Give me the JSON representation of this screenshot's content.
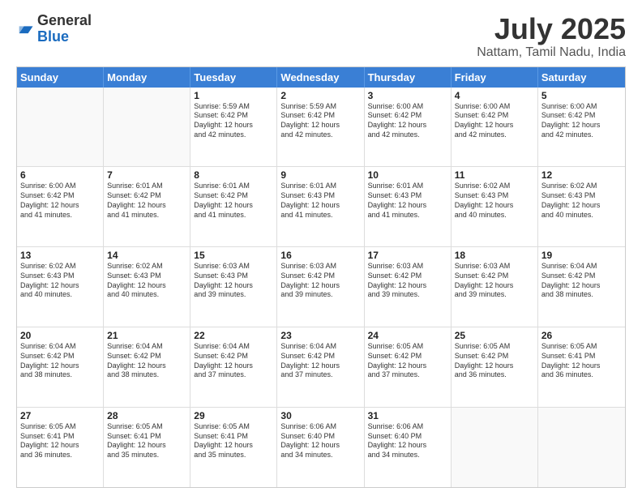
{
  "logo": {
    "general": "General",
    "blue": "Blue"
  },
  "header": {
    "title": "July 2025",
    "subtitle": "Nattam, Tamil Nadu, India"
  },
  "calendar": {
    "days": [
      "Sunday",
      "Monday",
      "Tuesday",
      "Wednesday",
      "Thursday",
      "Friday",
      "Saturday"
    ],
    "weeks": [
      [
        {
          "day": "",
          "empty": true
        },
        {
          "day": "",
          "empty": true
        },
        {
          "day": "1",
          "sunrise": "Sunrise: 5:59 AM",
          "sunset": "Sunset: 6:42 PM",
          "daylight": "Daylight: 12 hours and 42 minutes."
        },
        {
          "day": "2",
          "sunrise": "Sunrise: 5:59 AM",
          "sunset": "Sunset: 6:42 PM",
          "daylight": "Daylight: 12 hours and 42 minutes."
        },
        {
          "day": "3",
          "sunrise": "Sunrise: 6:00 AM",
          "sunset": "Sunset: 6:42 PM",
          "daylight": "Daylight: 12 hours and 42 minutes."
        },
        {
          "day": "4",
          "sunrise": "Sunrise: 6:00 AM",
          "sunset": "Sunset: 6:42 PM",
          "daylight": "Daylight: 12 hours and 42 minutes."
        },
        {
          "day": "5",
          "sunrise": "Sunrise: 6:00 AM",
          "sunset": "Sunset: 6:42 PM",
          "daylight": "Daylight: 12 hours and 42 minutes."
        }
      ],
      [
        {
          "day": "6",
          "sunrise": "Sunrise: 6:00 AM",
          "sunset": "Sunset: 6:42 PM",
          "daylight": "Daylight: 12 hours and 41 minutes."
        },
        {
          "day": "7",
          "sunrise": "Sunrise: 6:01 AM",
          "sunset": "Sunset: 6:42 PM",
          "daylight": "Daylight: 12 hours and 41 minutes."
        },
        {
          "day": "8",
          "sunrise": "Sunrise: 6:01 AM",
          "sunset": "Sunset: 6:42 PM",
          "daylight": "Daylight: 12 hours and 41 minutes."
        },
        {
          "day": "9",
          "sunrise": "Sunrise: 6:01 AM",
          "sunset": "Sunset: 6:43 PM",
          "daylight": "Daylight: 12 hours and 41 minutes."
        },
        {
          "day": "10",
          "sunrise": "Sunrise: 6:01 AM",
          "sunset": "Sunset: 6:43 PM",
          "daylight": "Daylight: 12 hours and 41 minutes."
        },
        {
          "day": "11",
          "sunrise": "Sunrise: 6:02 AM",
          "sunset": "Sunset: 6:43 PM",
          "daylight": "Daylight: 12 hours and 40 minutes."
        },
        {
          "day": "12",
          "sunrise": "Sunrise: 6:02 AM",
          "sunset": "Sunset: 6:43 PM",
          "daylight": "Daylight: 12 hours and 40 minutes."
        }
      ],
      [
        {
          "day": "13",
          "sunrise": "Sunrise: 6:02 AM",
          "sunset": "Sunset: 6:43 PM",
          "daylight": "Daylight: 12 hours and 40 minutes."
        },
        {
          "day": "14",
          "sunrise": "Sunrise: 6:02 AM",
          "sunset": "Sunset: 6:43 PM",
          "daylight": "Daylight: 12 hours and 40 minutes."
        },
        {
          "day": "15",
          "sunrise": "Sunrise: 6:03 AM",
          "sunset": "Sunset: 6:43 PM",
          "daylight": "Daylight: 12 hours and 39 minutes."
        },
        {
          "day": "16",
          "sunrise": "Sunrise: 6:03 AM",
          "sunset": "Sunset: 6:42 PM",
          "daylight": "Daylight: 12 hours and 39 minutes."
        },
        {
          "day": "17",
          "sunrise": "Sunrise: 6:03 AM",
          "sunset": "Sunset: 6:42 PM",
          "daylight": "Daylight: 12 hours and 39 minutes."
        },
        {
          "day": "18",
          "sunrise": "Sunrise: 6:03 AM",
          "sunset": "Sunset: 6:42 PM",
          "daylight": "Daylight: 12 hours and 39 minutes."
        },
        {
          "day": "19",
          "sunrise": "Sunrise: 6:04 AM",
          "sunset": "Sunset: 6:42 PM",
          "daylight": "Daylight: 12 hours and 38 minutes."
        }
      ],
      [
        {
          "day": "20",
          "sunrise": "Sunrise: 6:04 AM",
          "sunset": "Sunset: 6:42 PM",
          "daylight": "Daylight: 12 hours and 38 minutes."
        },
        {
          "day": "21",
          "sunrise": "Sunrise: 6:04 AM",
          "sunset": "Sunset: 6:42 PM",
          "daylight": "Daylight: 12 hours and 38 minutes."
        },
        {
          "day": "22",
          "sunrise": "Sunrise: 6:04 AM",
          "sunset": "Sunset: 6:42 PM",
          "daylight": "Daylight: 12 hours and 37 minutes."
        },
        {
          "day": "23",
          "sunrise": "Sunrise: 6:04 AM",
          "sunset": "Sunset: 6:42 PM",
          "daylight": "Daylight: 12 hours and 37 minutes."
        },
        {
          "day": "24",
          "sunrise": "Sunrise: 6:05 AM",
          "sunset": "Sunset: 6:42 PM",
          "daylight": "Daylight: 12 hours and 37 minutes."
        },
        {
          "day": "25",
          "sunrise": "Sunrise: 6:05 AM",
          "sunset": "Sunset: 6:42 PM",
          "daylight": "Daylight: 12 hours and 36 minutes."
        },
        {
          "day": "26",
          "sunrise": "Sunrise: 6:05 AM",
          "sunset": "Sunset: 6:41 PM",
          "daylight": "Daylight: 12 hours and 36 minutes."
        }
      ],
      [
        {
          "day": "27",
          "sunrise": "Sunrise: 6:05 AM",
          "sunset": "Sunset: 6:41 PM",
          "daylight": "Daylight: 12 hours and 36 minutes."
        },
        {
          "day": "28",
          "sunrise": "Sunrise: 6:05 AM",
          "sunset": "Sunset: 6:41 PM",
          "daylight": "Daylight: 12 hours and 35 minutes."
        },
        {
          "day": "29",
          "sunrise": "Sunrise: 6:05 AM",
          "sunset": "Sunset: 6:41 PM",
          "daylight": "Daylight: 12 hours and 35 minutes."
        },
        {
          "day": "30",
          "sunrise": "Sunrise: 6:06 AM",
          "sunset": "Sunset: 6:40 PM",
          "daylight": "Daylight: 12 hours and 34 minutes."
        },
        {
          "day": "31",
          "sunrise": "Sunrise: 6:06 AM",
          "sunset": "Sunset: 6:40 PM",
          "daylight": "Daylight: 12 hours and 34 minutes."
        },
        {
          "day": "",
          "empty": true
        },
        {
          "day": "",
          "empty": true
        }
      ]
    ]
  }
}
